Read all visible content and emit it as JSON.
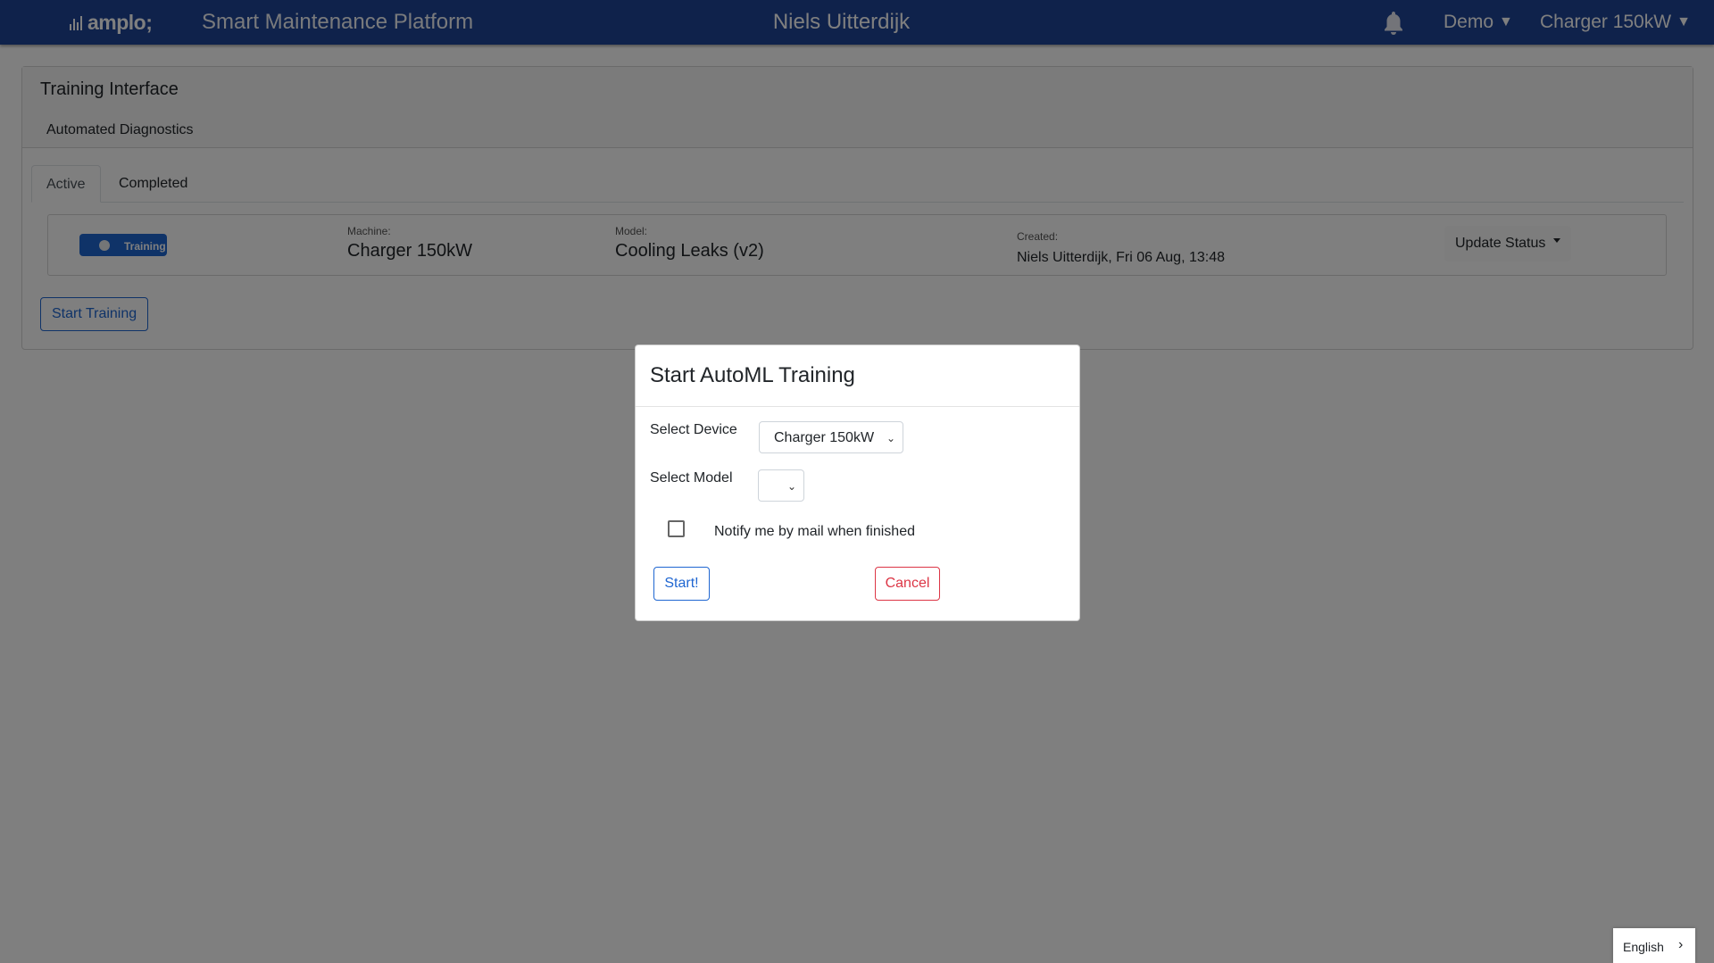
{
  "header": {
    "logo_text": "amplo;",
    "app_title": "Smart Maintenance Platform",
    "user_name": "Niels Uitterdijk",
    "notification_icon": "bell-icon",
    "menu_icon": "hamburger-icon",
    "account_dropdown": "Demo",
    "machine_dropdown": "Charger 150kW",
    "brand_color": "#1f4597"
  },
  "card": {
    "title": "Training Interface",
    "subtitle": "Automated Diagnostics",
    "tabs": [
      {
        "label": "Active",
        "active": true
      },
      {
        "label": "Completed",
        "active": false
      }
    ],
    "jobs": [
      {
        "status": "Training",
        "machine_caption": "Machine:",
        "machine": "Charger 150kW",
        "model_caption": "Model:",
        "model": "Cooling Leaks (v2)",
        "created_caption": "Created:",
        "created": "Niels Uitterdijk, Fri 06 Aug, 13:48",
        "update_label": "Update Status"
      }
    ],
    "start_training_label": "Start Training"
  },
  "modal": {
    "title": "Start AutoML Training",
    "device_label": "Select Device",
    "device_value": "Charger 150kW",
    "model_label": "Select Model",
    "model_value": "",
    "notify_label": "Notify me by mail when finished",
    "notify_checked": false,
    "start_label": "Start!",
    "cancel_label": "Cancel"
  },
  "language": {
    "label": "English"
  },
  "colors": {
    "primary": "#1f66d1",
    "danger": "#dc3545"
  }
}
